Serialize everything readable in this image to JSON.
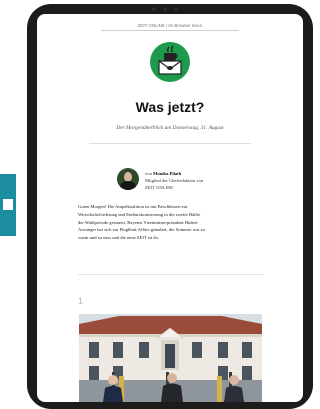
{
  "newsletter": {
    "top_link": "ZEIT ONLINE | Im Browser lesen",
    "title": "Was jetzt?",
    "subtitle": "Der Morgenüberblick am Donnerstag, 31. August"
  },
  "author": {
    "by": "von",
    "name": "Monika Pilath",
    "role": "Mitglied der Chefredaktion von",
    "org": "ZEIT ONLINE"
  },
  "body": {
    "lines": [
      "Guten Morgen! Die Ampelkoalition ist mit Beschlüssen zur",
      "Wirtschaftsförderung und Entbürokratisierung in die zweite Hälfte",
      "der Wahlperiode gestartet, Bayerns Vizeministerpräsident Hubert",
      "Aiwanger hat sich zur Flugblatt-Affäre geäußert, der Sommer war zu",
      "warm und zu nass und die neue ZEIT ist da."
    ]
  },
  "section": {
    "number": "1"
  },
  "colors": {
    "logo_green": "#1e9a4d",
    "side_tab": "#1c8da0",
    "device_frame": "#1c1c1c"
  },
  "icons": {
    "logo": "envelope-coffee-icon"
  }
}
